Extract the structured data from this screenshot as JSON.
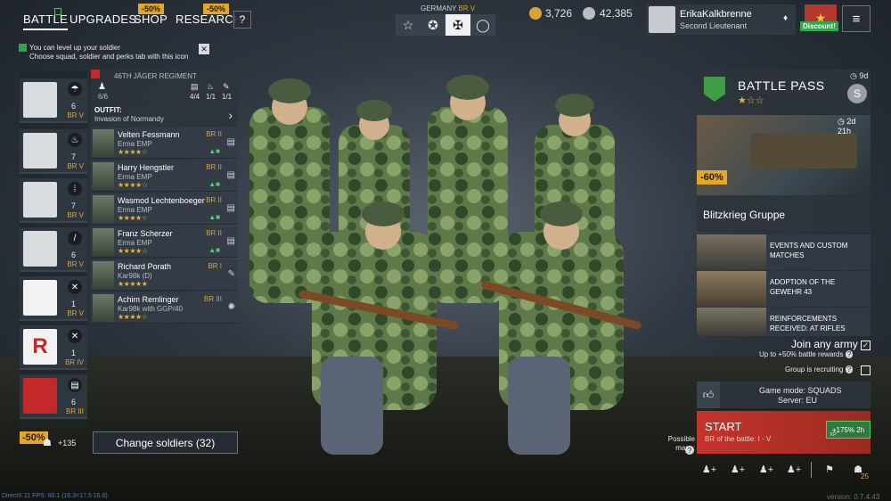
{
  "tabs": {
    "battle": "BATTLE",
    "upgrades": "UPGRADES",
    "shop": "SHOP",
    "research": "RESEARCH",
    "help": "?",
    "shop_sale": "-50%",
    "research_sale": "-50%"
  },
  "faction": {
    "nation": "GERMANY",
    "br": "BR V"
  },
  "currency": {
    "gold": "3,726",
    "silver": "42,385"
  },
  "profile": {
    "name": "ErikaKalkbrenne",
    "rank": "Second Lieutenant",
    "discount": "Discount!"
  },
  "notice": {
    "line1": "You can level up your soldier",
    "line2": "Choose squad, soldier and perks tab with this icon"
  },
  "squad_panel": {
    "regiment": "46TH JÄGER REGIMENT",
    "count": "6/6",
    "s1": "4/4",
    "s2": "1/1",
    "s3": "1/1",
    "outfit_label": "OUTFIT:",
    "outfit_value": "Invasion of Normandy"
  },
  "squads": [
    {
      "count": "6",
      "br": "BR V"
    },
    {
      "count": "7",
      "br": "BR V"
    },
    {
      "count": "7",
      "br": "BR V"
    },
    {
      "count": "6",
      "br": "BR V"
    },
    {
      "count": "1",
      "br": "BR V"
    },
    {
      "count": "1",
      "br": "BR IV"
    },
    {
      "count": "6",
      "br": "BR III"
    }
  ],
  "soldiers": [
    {
      "name": "Velten Fessmann",
      "weapon": "Erma EMP",
      "stars": "★★★★☆",
      "br": "BR II"
    },
    {
      "name": "Harry Hengstler",
      "weapon": "Erma EMP",
      "stars": "★★★★☆",
      "br": "BR II"
    },
    {
      "name": "Wasmod Lechtenboeger",
      "weapon": "Erma EMP",
      "stars": "★★★★☆",
      "br": "BR II"
    },
    {
      "name": "Franz Scherzer",
      "weapon": "Erma EMP",
      "stars": "★★★★☆",
      "br": "BR II"
    },
    {
      "name": "Richard Porath",
      "weapon": "Kar98k (D)",
      "stars": "★★★★★",
      "br": "BR I"
    },
    {
      "name": "Achim Remlinger",
      "weapon": "Kar98k with GGP/40",
      "stars": "★★★★☆",
      "br": "BR III"
    }
  ],
  "bottom_left": {
    "sale": "-50%",
    "plus": "+135",
    "change_soldiers": "Change soldiers (32)"
  },
  "battle_pass": {
    "title": "BATTLE PASS",
    "stars": "★☆☆",
    "timer": "9d",
    "promo_timer": "2d 21h",
    "promo_discount": "-60%",
    "promo_name": "Blitzkrieg Gruppe",
    "level_badge": "S"
  },
  "events": [
    {
      "text": "EVENTS AND CUSTOM MATCHES"
    },
    {
      "text": "ADOPTION OF THE GEWEHR 43"
    },
    {
      "text": "REINFORCEMENTS RECEIVED: AT RIFLES"
    }
  ],
  "join": {
    "title": "Join any army",
    "subtitle": "Up to +50% battle rewards",
    "group": "Group is recruiting"
  },
  "mode": {
    "game_mode": "Game mode: SQUADS",
    "server": "Server: EU"
  },
  "start": {
    "label": "START",
    "sub": "BR of the battle: I - V",
    "xp": "+175% 2h",
    "xp_label": "XP"
  },
  "maps": {
    "label": "Possible maps:"
  },
  "footer": {
    "fps": "DirectX 11 FPS: 60.1 (16.3<17.5 16.6)",
    "version": "version: 0.7.4.43",
    "player_count": "25"
  }
}
